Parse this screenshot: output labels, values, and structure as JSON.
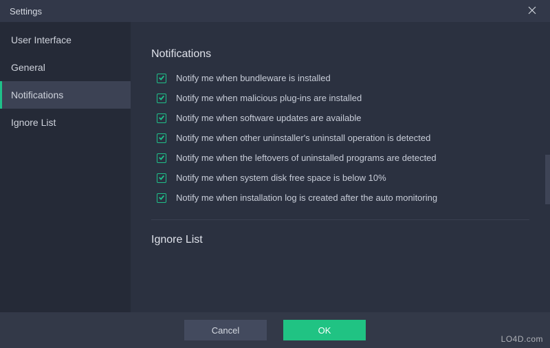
{
  "window": {
    "title": "Settings"
  },
  "sidebar": {
    "items": [
      {
        "label": "User Interface"
      },
      {
        "label": "General"
      },
      {
        "label": "Notifications"
      },
      {
        "label": "Ignore List"
      }
    ],
    "activeIndex": 2
  },
  "sections": {
    "notifications": {
      "title": "Notifications",
      "options": [
        {
          "checked": true,
          "label": "Notify me when bundleware is installed"
        },
        {
          "checked": true,
          "label": "Notify me when malicious plug-ins are installed"
        },
        {
          "checked": true,
          "label": "Notify me when software updates are available"
        },
        {
          "checked": true,
          "label": "Notify me when other uninstaller's uninstall operation is detected"
        },
        {
          "checked": true,
          "label": "Notify me when the leftovers of uninstalled programs are detected"
        },
        {
          "checked": true,
          "label": "Notify me when system disk free space is below 10%"
        },
        {
          "checked": true,
          "label": "Notify me when installation log is created after the auto monitoring"
        }
      ]
    },
    "ignoreList": {
      "title": "Ignore List"
    }
  },
  "footer": {
    "cancel_label": "Cancel",
    "ok_label": "OK"
  },
  "colors": {
    "accent": "#20c383",
    "bg": "#2b3140",
    "sidebar": "#252a37",
    "titlebar": "#323849"
  },
  "watermark": "LO4D.com"
}
